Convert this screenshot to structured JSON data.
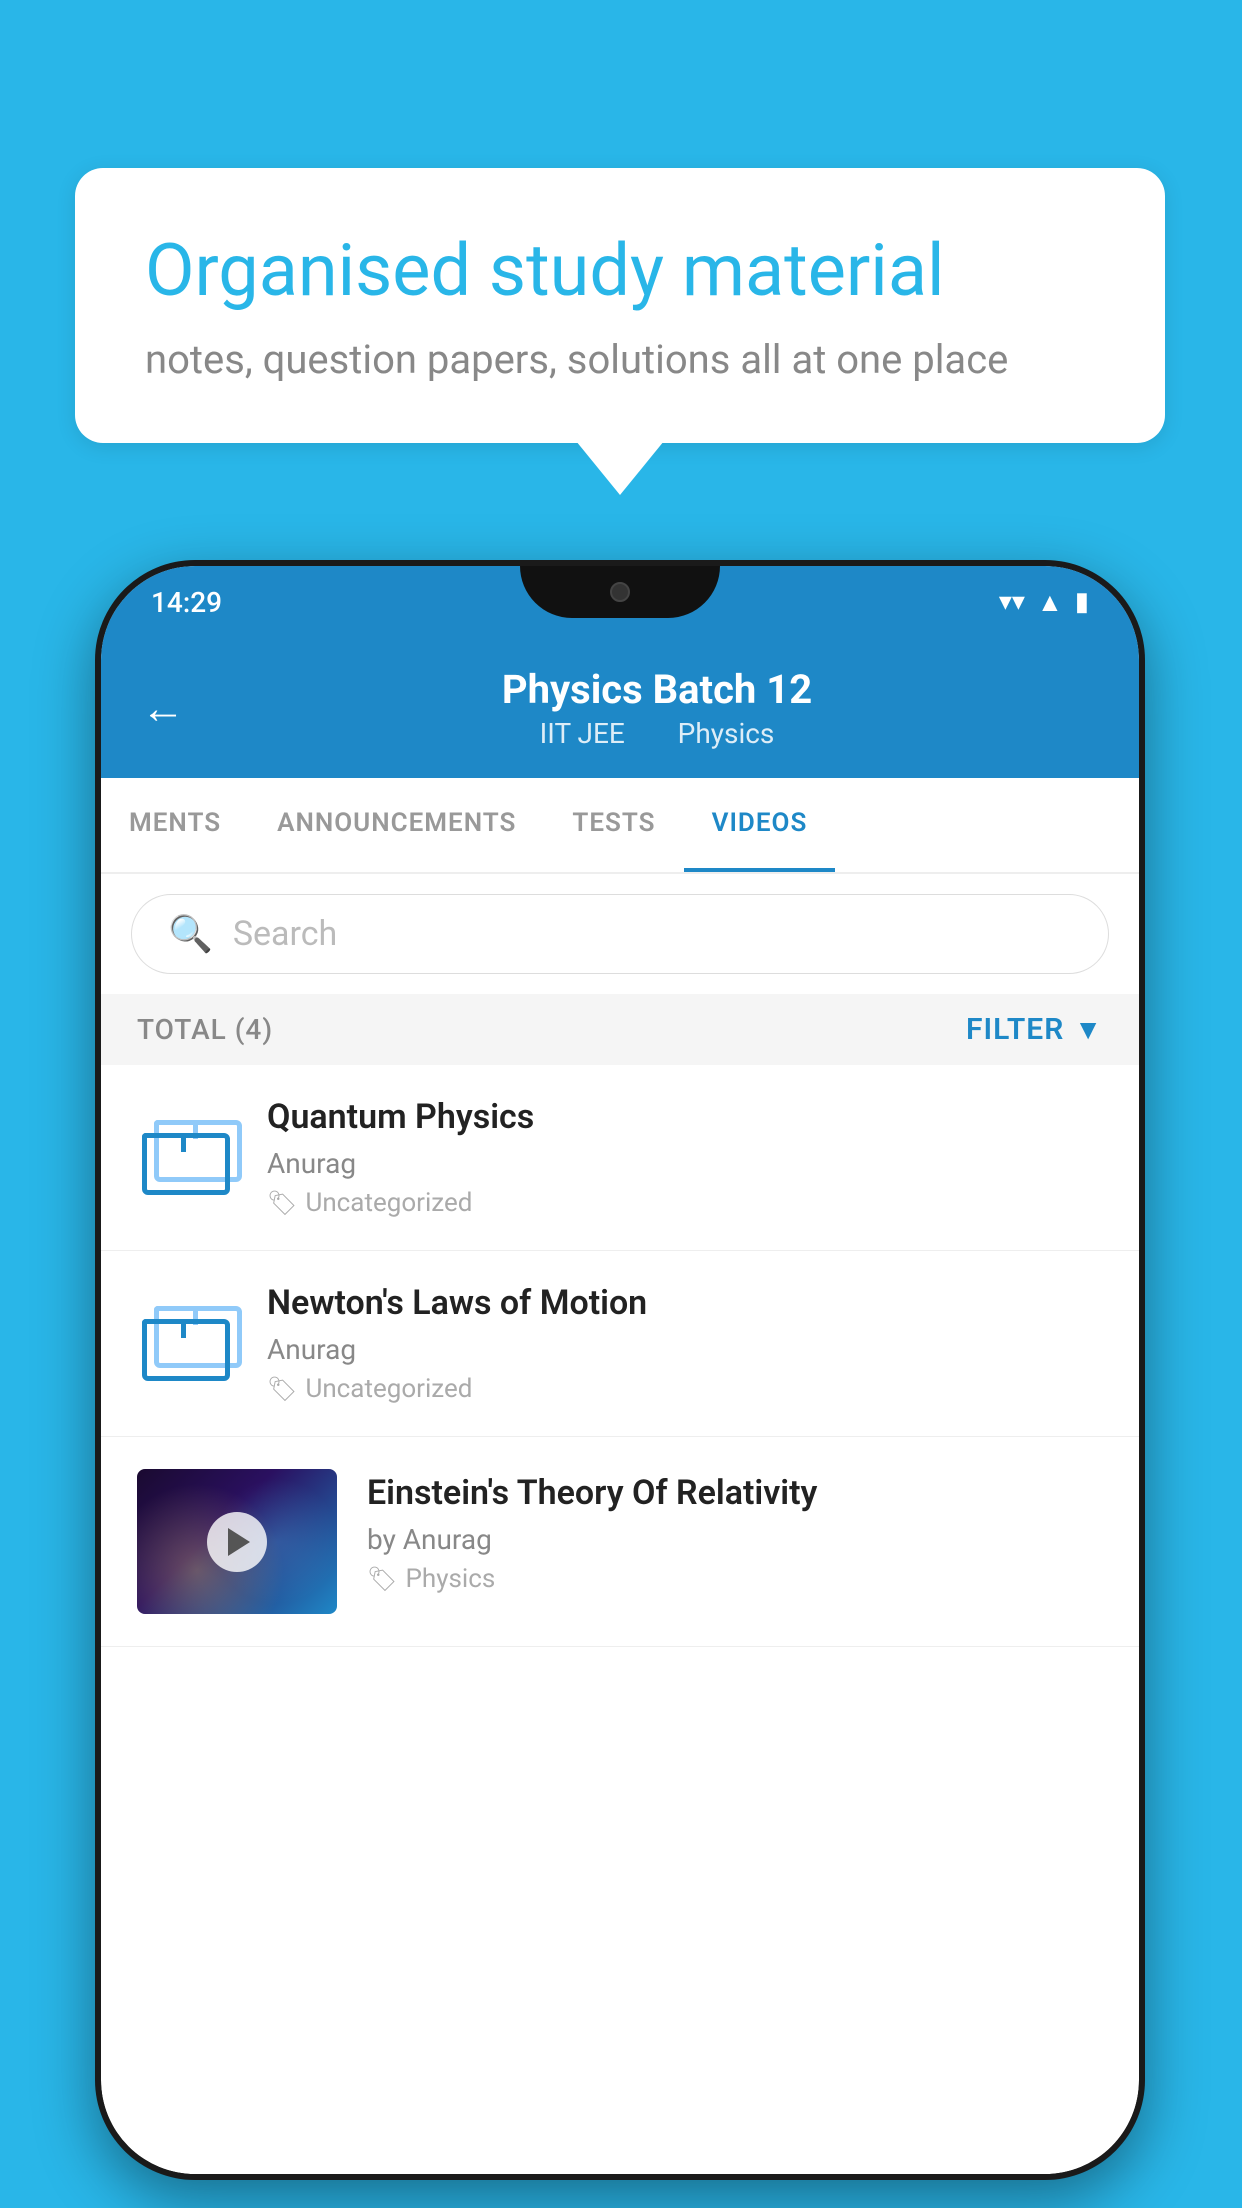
{
  "background_color": "#29b6e8",
  "bubble": {
    "title": "Organised study material",
    "subtitle": "notes, question papers, solutions all at one place"
  },
  "phone": {
    "status_bar": {
      "time": "14:29",
      "wifi_icon": "wifi",
      "signal_icon": "signal",
      "battery_icon": "battery"
    },
    "header": {
      "back_label": "←",
      "title": "Physics Batch 12",
      "subtitle_left": "IIT JEE",
      "subtitle_right": "Physics"
    },
    "tabs": [
      {
        "label": "MENTS",
        "active": false
      },
      {
        "label": "ANNOUNCEMENTS",
        "active": false
      },
      {
        "label": "TESTS",
        "active": false
      },
      {
        "label": "VIDEOS",
        "active": true
      }
    ],
    "search": {
      "placeholder": "Search"
    },
    "filter_bar": {
      "total_label": "TOTAL (4)",
      "filter_label": "FILTER"
    },
    "videos": [
      {
        "id": 1,
        "title": "Quantum Physics",
        "author": "Anurag",
        "tag": "Uncategorized",
        "has_thumbnail": false
      },
      {
        "id": 2,
        "title": "Newton's Laws of Motion",
        "author": "Anurag",
        "tag": "Uncategorized",
        "has_thumbnail": false
      },
      {
        "id": 3,
        "title": "Einstein's Theory Of Relativity",
        "author": "by Anurag",
        "tag": "Physics",
        "has_thumbnail": true
      }
    ]
  }
}
